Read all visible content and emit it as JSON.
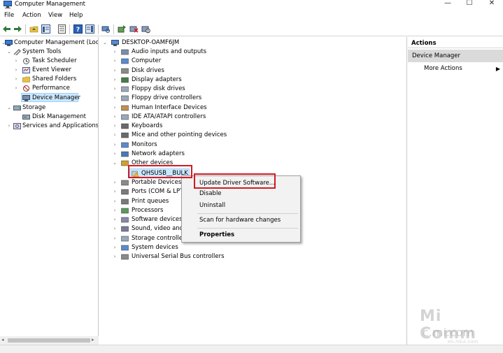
{
  "window": {
    "title": "Computer Management",
    "minimize_glyph": "—",
    "maximize_glyph": "☐",
    "close_glyph": "✕"
  },
  "menu": [
    "File",
    "Action",
    "View",
    "Help"
  ],
  "left_tree": {
    "root": "Computer Management (Local",
    "system_tools": "System Tools",
    "task_scheduler": "Task Scheduler",
    "event_viewer": "Event Viewer",
    "shared_folders": "Shared Folders",
    "performance": "Performance",
    "device_manager": "Device Manager",
    "storage": "Storage",
    "disk_management": "Disk Management",
    "services": "Services and Applications"
  },
  "device_tree": {
    "computer_name": "DESKTOP-OAMF6JM",
    "categories": [
      "Audio inputs and outputs",
      "Computer",
      "Disk drives",
      "Display adapters",
      "Floppy disk drives",
      "Floppy drive controllers",
      "Human Interface Devices",
      "IDE ATA/ATAPI controllers",
      "Keyboards",
      "Mice and other pointing devices",
      "Monitors",
      "Network adapters",
      "Other devices"
    ],
    "selected_device": "QHSUSB__BULK",
    "categories_after": [
      "Portable Devices",
      "Ports (COM & LPT",
      "Print queues",
      "Processors",
      "Software devices",
      "Sound, video and",
      "Storage controller",
      "System devices",
      "Universal Serial Bus controllers"
    ]
  },
  "context_menu": {
    "update": "Update Driver Software...",
    "disable": "Disable",
    "uninstall": "Uninstall",
    "scan": "Scan for hardware changes",
    "properties": "Properties"
  },
  "actions": {
    "header": "Actions",
    "section": "Device Manager",
    "more": "More Actions",
    "more_arrow": "▶"
  },
  "watermark": {
    "line1": "Mi Comm",
    "line2": "c.mi.com",
    "line3": "en.miui.com"
  },
  "colors": {
    "highlight_box": "#d01c24",
    "selection": "#cce8ff",
    "actions_subheader": "#dadada"
  }
}
